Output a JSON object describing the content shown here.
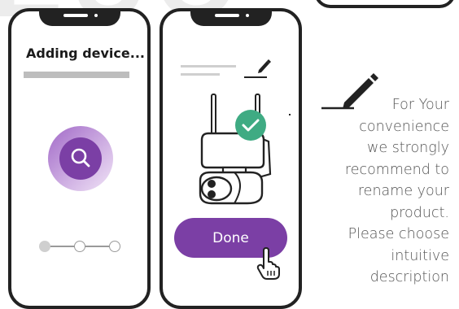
{
  "bg_letters": "EUO",
  "phone1": {
    "title": "Adding device...",
    "progress": 0.0,
    "steps_total": 3,
    "steps_active": 1,
    "icon": "search-icon"
  },
  "phone2": {
    "icon": "pencil-icon",
    "camera_icon": "security-camera-icon",
    "status_icon": "check-icon",
    "done_label": "Done",
    "cursor_icon": "hand-pointer-icon"
  },
  "instruction": {
    "icon": "pencil-icon",
    "lines": [
      "For Your",
      "convenience",
      "we strongly",
      "recommend to",
      "rename your",
      "product.",
      "Please choose",
      "intuitive",
      "description"
    ]
  },
  "colors": {
    "accent": "#7b3fa5",
    "accent_light": "#d7b9e4",
    "check_green": "#3fab83",
    "outline": "#222222"
  }
}
